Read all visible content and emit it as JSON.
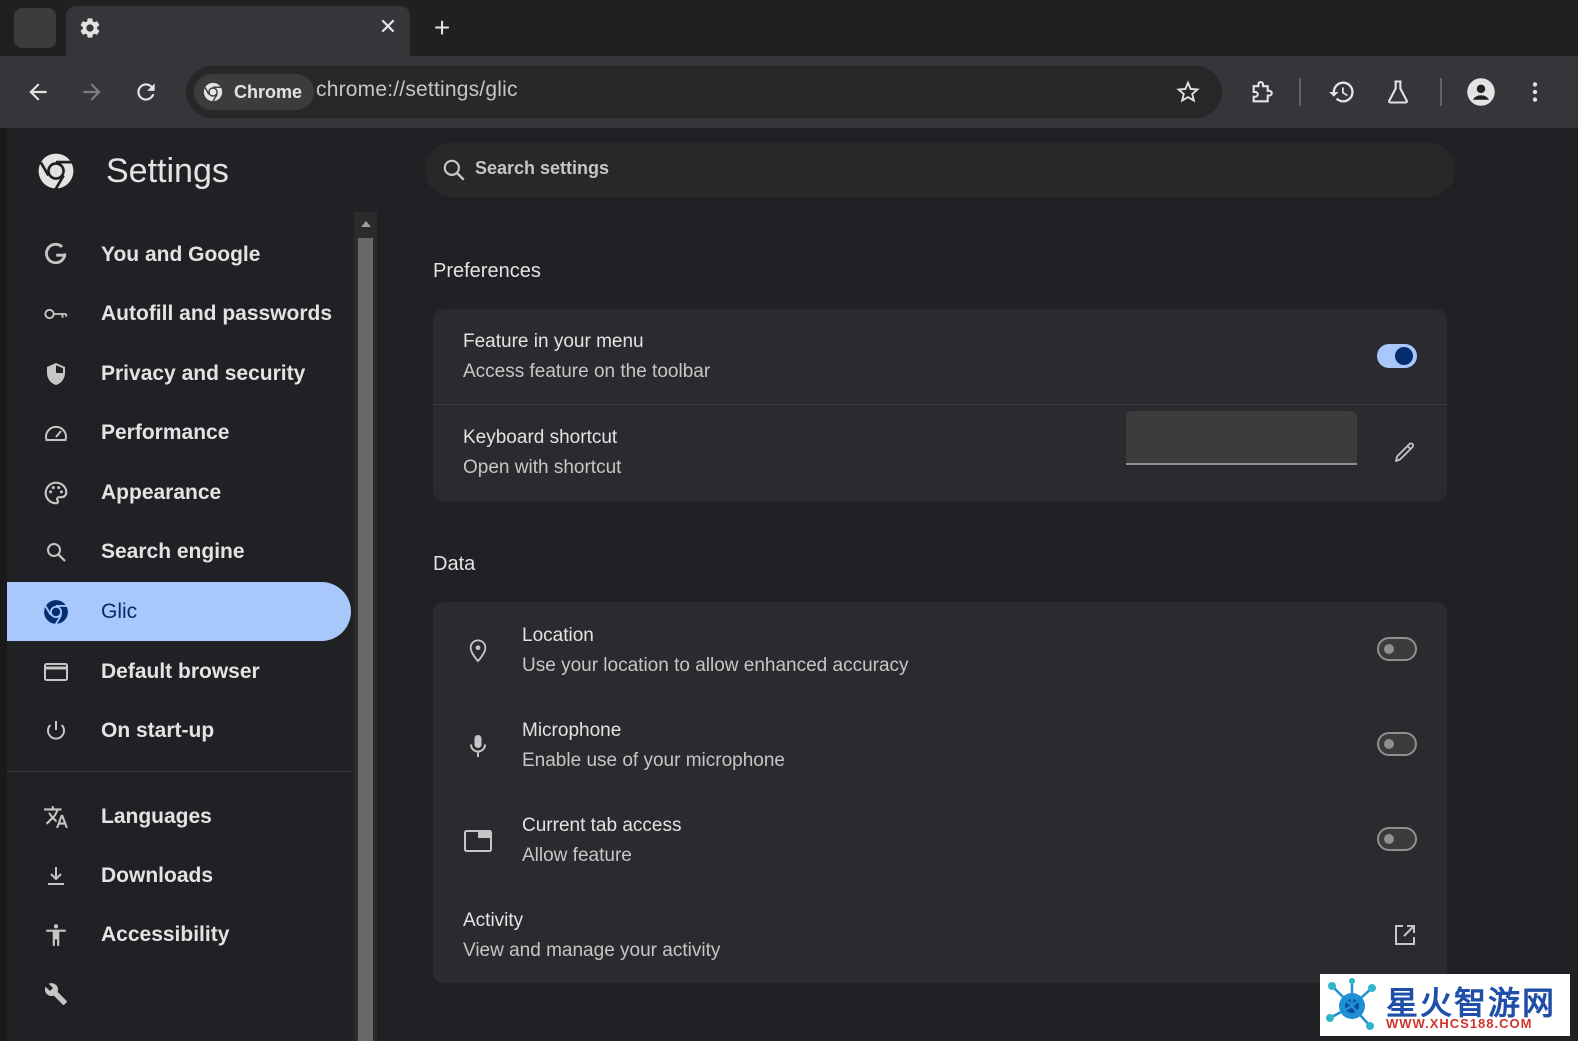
{
  "browser": {
    "new_tab_glyph": "+",
    "close_glyph": "✕",
    "chip_label": "Chrome",
    "url": "chrome://settings/glic",
    "icons": [
      "settings-gear-icon",
      "back-arrow-icon",
      "forward-arrow-icon",
      "reload-icon",
      "chrome-logo-icon",
      "bookmark-star-icon",
      "extensions-puzzle-icon",
      "history-icon",
      "labs-flask-icon",
      "profile-avatar-icon",
      "more-vertical-icon"
    ]
  },
  "sidebar": {
    "title": "Settings",
    "items": [
      {
        "label": "You and Google",
        "icon": "google-g-icon"
      },
      {
        "label": "Autofill and passwords",
        "icon": "key-icon"
      },
      {
        "label": "Privacy and security",
        "icon": "shield-icon"
      },
      {
        "label": "Performance",
        "icon": "speedometer-icon"
      },
      {
        "label": "Appearance",
        "icon": "palette-icon"
      },
      {
        "label": "Search engine",
        "icon": "search-icon"
      },
      {
        "label": "Glic",
        "icon": "chrome-logo-icon",
        "active": true
      },
      {
        "label": "Default browser",
        "icon": "browser-window-icon"
      },
      {
        "label": "On start-up",
        "icon": "power-icon"
      },
      {
        "label": "Languages",
        "icon": "translate-icon"
      },
      {
        "label": "Downloads",
        "icon": "download-icon"
      },
      {
        "label": "Accessibility",
        "icon": "accessibility-icon"
      },
      {
        "label": "",
        "icon": "wrench-icon"
      }
    ]
  },
  "search": {
    "placeholder": "Search settings"
  },
  "preferences": {
    "title": "Preferences",
    "feature_menu": {
      "title": "Feature in your menu",
      "subtitle": "Access feature on the toolbar",
      "enabled": true
    },
    "keyboard_shortcut": {
      "title": "Keyboard shortcut",
      "subtitle": "Open with shortcut",
      "value": ""
    }
  },
  "data_section": {
    "title": "Data",
    "location": {
      "title": "Location",
      "subtitle": "Use your location to allow enhanced accuracy",
      "enabled": false
    },
    "microphone": {
      "title": "Microphone",
      "subtitle": "Enable use of your microphone",
      "enabled": false
    },
    "tab_access": {
      "title": "Current tab access",
      "subtitle": "Allow feature",
      "enabled": false
    },
    "activity": {
      "title": "Activity",
      "subtitle": "View and manage your activity"
    }
  },
  "watermark": {
    "title": "星火智游网",
    "url": "WWW.XHCS188.COM"
  },
  "colors": {
    "accent": "#a8c7fa",
    "accent_dark": "#062e6f",
    "background": "#202124",
    "card": "#2a2b2e"
  }
}
